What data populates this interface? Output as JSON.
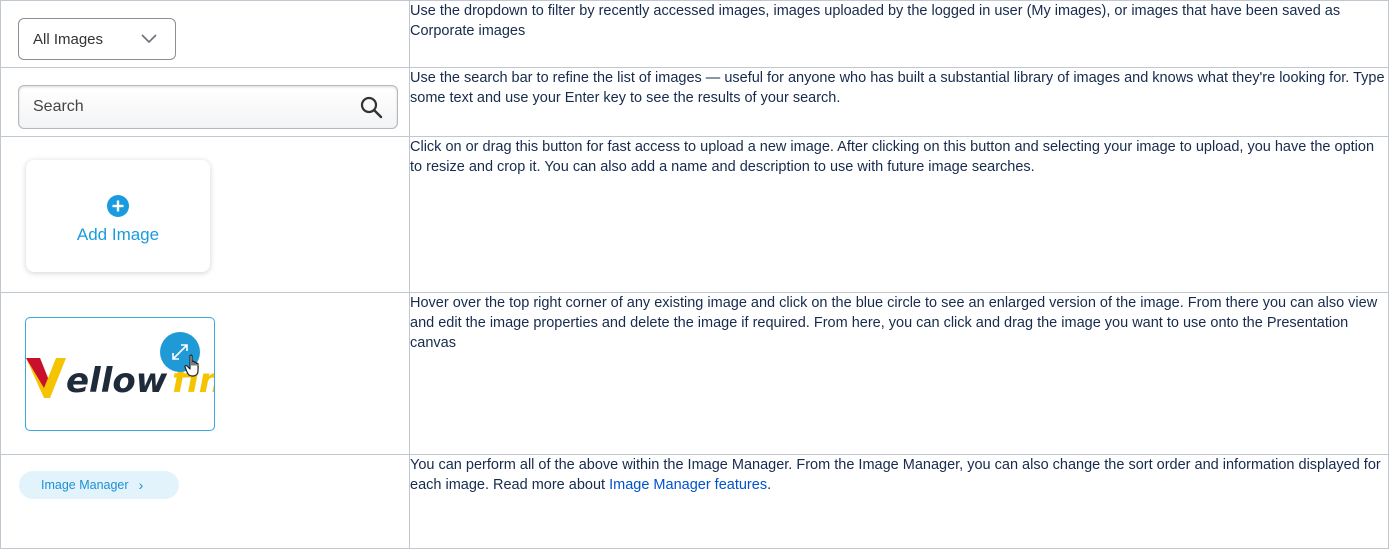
{
  "rows": {
    "dropdown": {
      "selected": "All Images",
      "icon": "chevron-down-icon",
      "description": "Use the dropdown to filter by recently accessed images, images uploaded by the logged in user (My images), or images that have been saved as Corporate images"
    },
    "search": {
      "placeholder": "Search",
      "icon": "search-icon",
      "description": "Use the search bar to refine the list of images — useful for anyone who has built a substantial library of images and knows what they're looking for. Type some text and use your Enter key to see the results of your search."
    },
    "add_image": {
      "label": "Add Image",
      "icon": "plus-circle-icon",
      "description": "Click on or drag this button for fast access to upload a new image. After clicking on this button and selecting your image to upload, you have the option to resize and crop it. You can also add a name and description to use with future image searches."
    },
    "thumbnail": {
      "logo_text": "ellow",
      "logo_tail": "fin",
      "icons": [
        "expand-icon",
        "hand-cursor-icon"
      ],
      "description": "Hover over the top right corner of any existing image and click on the blue circle to see an enlarged version of the image. From there you can also view and edit the image properties and delete the image if required. From here, you can click and drag the image you want to use onto the Presentation canvas"
    },
    "image_manager": {
      "label": "Image Manager",
      "arrow": "›",
      "description_before": "You can perform all of the above within the Image Manager. From the Image Manager, you can also change the sort order and information displayed for each image. Read more about ",
      "link_text": "Image Manager features",
      "description_after": "."
    }
  },
  "colors": {
    "accent": "#1a9be0",
    "link": "#0052cc",
    "border": "#c1c7d0",
    "logo_yellow": "#f5c400",
    "logo_red": "#c8102e"
  }
}
